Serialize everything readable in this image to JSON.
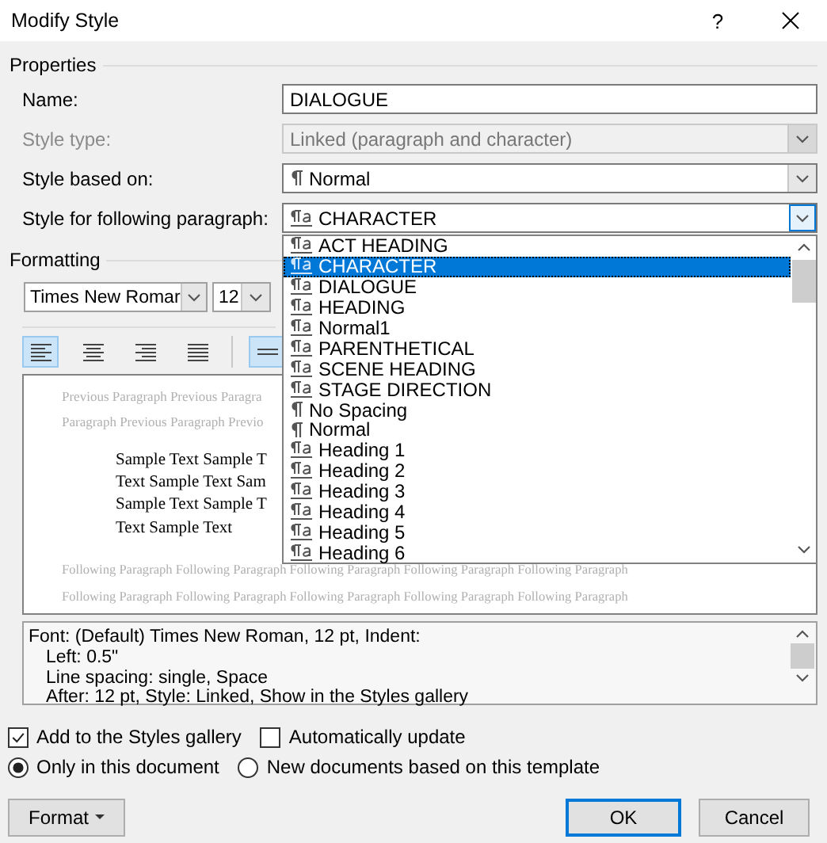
{
  "window": {
    "title": "Modify Style",
    "help": "?"
  },
  "properties": {
    "heading": "Properties",
    "fields": [
      {
        "label": "Name:",
        "kind": "text",
        "value": "DIALOGUE",
        "disabled": false
      },
      {
        "label": "Style type:",
        "kind": "combo",
        "value": "Linked (paragraph and character)",
        "disabled": true
      },
      {
        "label": "Style based on:",
        "kind": "paragraph-combo",
        "value": "Normal",
        "disabled": false
      },
      {
        "label": "Style for following paragraph:",
        "kind": "linked-combo",
        "value": "CHARACTER",
        "disabled": false,
        "expanded": true
      }
    ]
  },
  "dropdown": {
    "items": [
      {
        "label": "ACT HEADING",
        "kind": "linked",
        "selected": false
      },
      {
        "label": "CHARACTER",
        "kind": "linked",
        "selected": true
      },
      {
        "label": "DIALOGUE",
        "kind": "linked",
        "selected": false
      },
      {
        "label": "HEADING",
        "kind": "linked",
        "selected": false
      },
      {
        "label": "Normal1",
        "kind": "linked",
        "selected": false
      },
      {
        "label": "PARENTHETICAL",
        "kind": "linked",
        "selected": false
      },
      {
        "label": "SCENE HEADING",
        "kind": "linked",
        "selected": false
      },
      {
        "label": "STAGE DIRECTION",
        "kind": "linked",
        "selected": false
      },
      {
        "label": "No Spacing",
        "kind": "paragraph",
        "selected": false
      },
      {
        "label": "Normal",
        "kind": "paragraph",
        "selected": false
      },
      {
        "label": "Heading 1",
        "kind": "linked",
        "selected": false
      },
      {
        "label": "Heading 2",
        "kind": "linked",
        "selected": false
      },
      {
        "label": "Heading 3",
        "kind": "linked",
        "selected": false
      },
      {
        "label": "Heading 4",
        "kind": "linked",
        "selected": false
      },
      {
        "label": "Heading 5",
        "kind": "linked",
        "selected": false
      },
      {
        "label": "Heading 6",
        "kind": "linked",
        "selected": false
      }
    ]
  },
  "formatting": {
    "heading": "Formatting",
    "font": "Times New Romar",
    "size": "12",
    "tools": [
      {
        "kind": "align-left",
        "selected": true
      },
      {
        "kind": "align-center",
        "selected": false
      },
      {
        "kind": "align-right",
        "selected": false
      },
      {
        "kind": "justify",
        "selected": false
      },
      {
        "kind": "line-spacing",
        "selected": true
      }
    ]
  },
  "preview": {
    "previous": [
      "Previous Paragraph Previous Paragra",
      "Paragraph Previous Paragraph Previo"
    ],
    "sample": [
      "Sample Text Sample T",
      "Text Sample Text Sam",
      "Sample Text Sample T",
      "Text Sample Text"
    ],
    "following": [
      "Following Paragraph Following Paragraph Following Paragraph Following Paragraph Following Paragraph",
      "Following Paragraph Following Paragraph Following Paragraph Following Paragraph Following Paragraph"
    ]
  },
  "description": [
    "Font: (Default) Times New Roman, 12 pt, Indent:",
    "Left:  0.5\"",
    "Line spacing:  single, Space",
    "After:  12 pt, Style: Linked, Show in the Styles gallery"
  ],
  "checkboxes": [
    {
      "label": "Add to the Styles gallery",
      "checked": true
    },
    {
      "label": "Automatically update",
      "checked": false
    }
  ],
  "radios": [
    {
      "label": "Only in this document",
      "selected": true
    },
    {
      "label": "New documents based on this template",
      "selected": false
    }
  ],
  "buttons": {
    "format": "Format",
    "ok": "OK",
    "cancel": "Cancel"
  }
}
